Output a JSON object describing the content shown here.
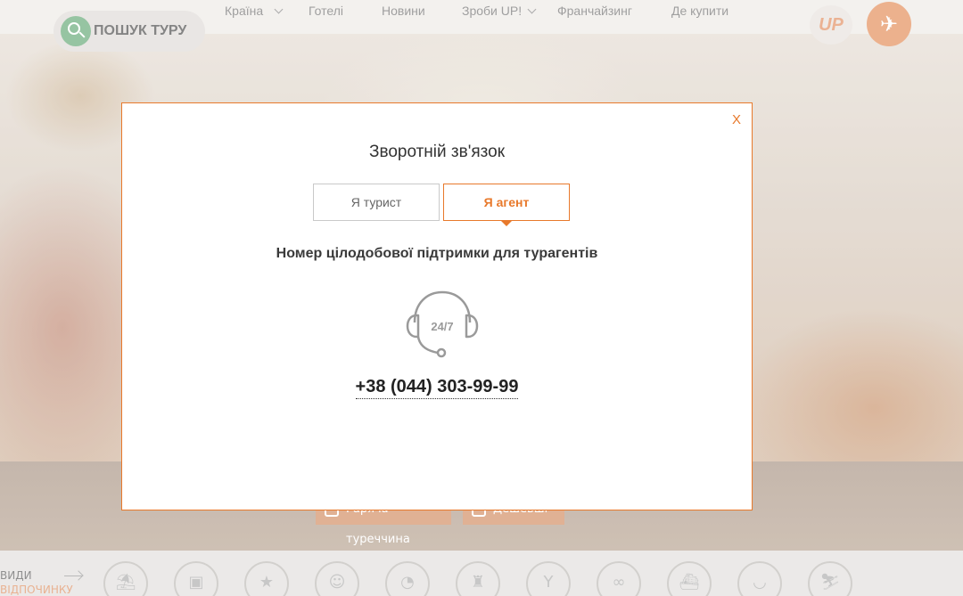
{
  "header": {
    "search_label": "ПОШУК ТУРУ",
    "nav": [
      {
        "label": "Країна",
        "has_dropdown": true
      },
      {
        "label": "Готелі",
        "has_dropdown": false
      },
      {
        "label": "Новини",
        "has_dropdown": false
      },
      {
        "label": "Зроби UP!",
        "has_dropdown": true
      },
      {
        "label": "Франчайзинг",
        "has_dropdown": false
      },
      {
        "label": "Де купити",
        "has_dropdown": false
      }
    ],
    "logo_text": "UP",
    "icons": [
      "search-icon",
      "plane-icon"
    ]
  },
  "background": {
    "tags": [
      "Гаряча туреччина",
      "Дешевші"
    ],
    "bottom_label_line1": "ВИДИ",
    "bottom_label_line2": "ВІДПОЧИНКУ"
  },
  "modal": {
    "close_label": "X",
    "title": "Зворотній зв'язок",
    "tabs": [
      {
        "label": "Я турист",
        "active": false
      },
      {
        "label": "Я агент",
        "active": true
      }
    ],
    "support_title": "Номер цілодобової підтримки для турагентів",
    "icon_text": "24/7",
    "phone": "+38 (044) 303-99-99"
  },
  "colors": {
    "accent": "#e8792b",
    "search_green": "#7fb78e",
    "modal_bg": "#ffffff"
  }
}
